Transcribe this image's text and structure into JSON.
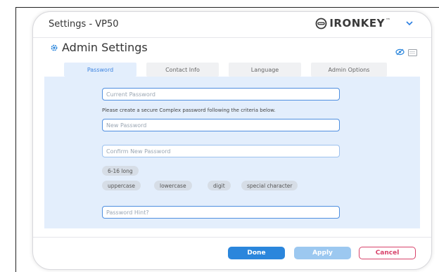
{
  "window": {
    "title": "Settings - VP50",
    "brand": "IRONKEY",
    "brand_tm": "™",
    "brand_icon": "ironkey-logo-icon",
    "menu_icon": "chevron-down-icon"
  },
  "header": {
    "title": "Admin Settings",
    "icon": "gear-icon"
  },
  "tabs": [
    {
      "label": "Password",
      "active": true
    },
    {
      "label": "Contact Info",
      "active": false
    },
    {
      "label": "Language",
      "active": false
    },
    {
      "label": "Admin Options",
      "active": false
    }
  ],
  "form": {
    "current_password_placeholder": "Current Password",
    "criteria_text": "Please create a secure Complex password following the criteria below.",
    "new_password_placeholder": "New Password",
    "confirm_password_placeholder": "Confirm New Password",
    "hint_placeholder": "Password Hint?"
  },
  "criteria": [
    "6-16 long",
    "uppercase",
    "lowercase",
    "digit",
    "special character"
  ],
  "buttons": {
    "done": "Done",
    "apply": "Apply",
    "cancel": "Cancel"
  },
  "colors": {
    "accent": "#2b86dc",
    "apply_disabled": "#9cc8f0",
    "cancel": "#d8426a",
    "panel_bg": "#e3eefc"
  }
}
